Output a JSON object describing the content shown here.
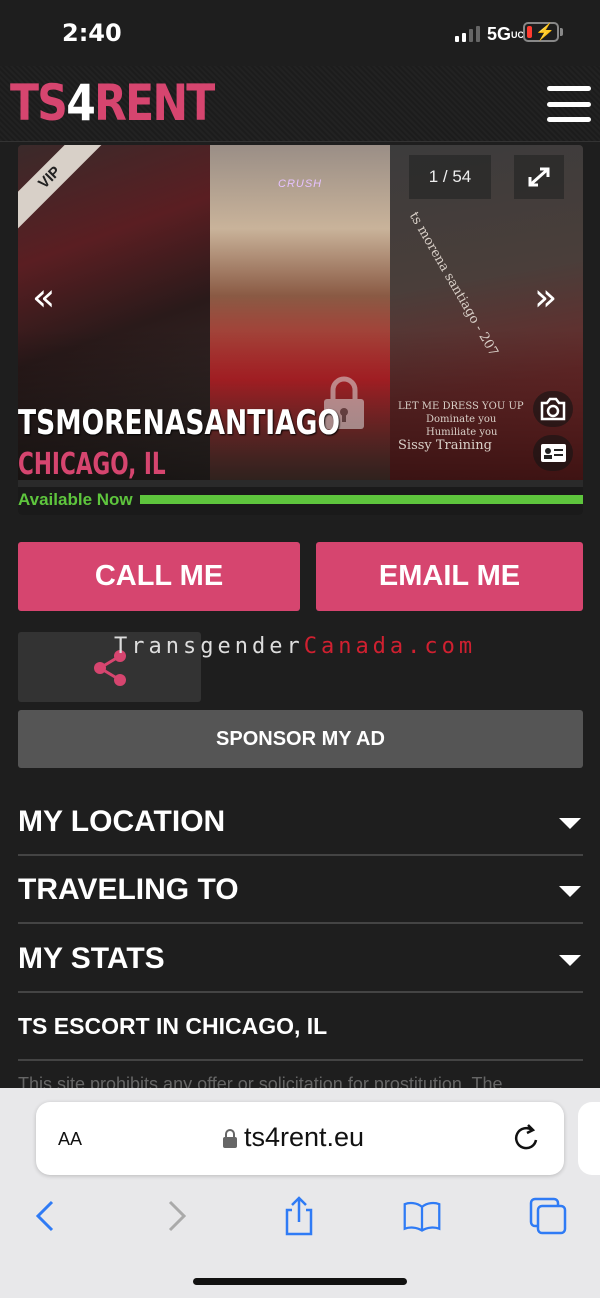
{
  "status_bar": {
    "time": "2:40",
    "network": "5G",
    "network_suffix": "UC"
  },
  "header": {
    "logo_ts": "TS",
    "logo_four": "4",
    "logo_rent": "RENT"
  },
  "gallery": {
    "vip": "VIP",
    "counter": "1 / 54",
    "profile_name": "TSMORENASANTIAGO",
    "location": "CHICAGO, IL",
    "availability": "Available Now",
    "photo_2_caption": "CRUSH",
    "photo_3_text": [
      "ts morena santiago - 207",
      "LET ME DRESS YOU UP",
      "Dominate you",
      "Humiliate you",
      "Sissy Training"
    ]
  },
  "actions": {
    "call": "CALL ME",
    "email": "EMAIL ME",
    "sponsor": "SPONSOR MY AD"
  },
  "watermark": {
    "white": "Transgender",
    "red": "Canada.com"
  },
  "sections": [
    {
      "label": "MY LOCATION"
    },
    {
      "label": "TRAVELING TO"
    },
    {
      "label": "MY STATS"
    }
  ],
  "seo_heading": "TS ESCORT IN CHICAGO, IL",
  "disclaimer": "This site prohibits any offer or solicitation for prostitution. The",
  "safari": {
    "aa": "AA",
    "url": "ts4rent.eu"
  },
  "colors": {
    "brand_pink": "#d6456f",
    "available_green": "#5ec53d",
    "background": "#1e1e1e"
  }
}
